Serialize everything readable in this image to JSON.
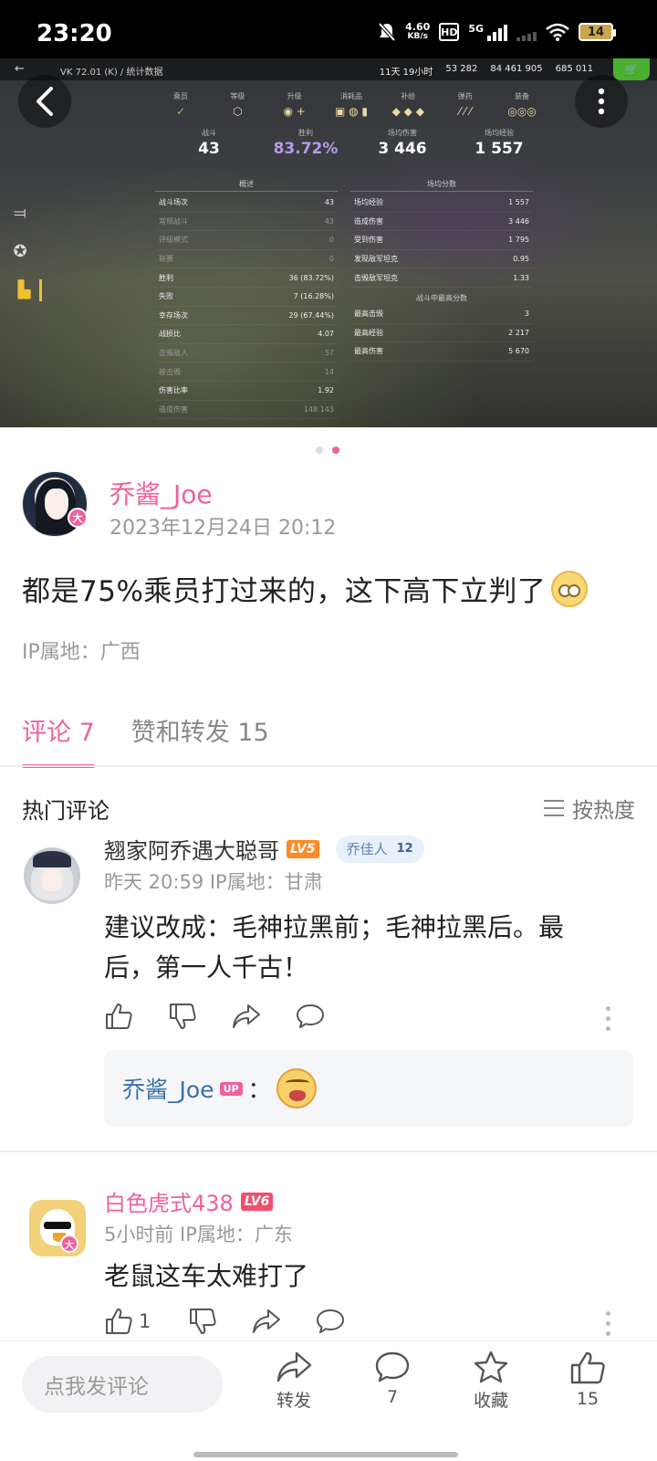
{
  "status_bar": {
    "time": "23:20",
    "net_speed_value": "4.60",
    "net_speed_unit": "KB/s",
    "hd": "HD",
    "network": "5G",
    "battery": "14"
  },
  "hero": {
    "topbar_title": "VK 72.01 (K) / 统计数据",
    "topbar_time": "11天 19小时",
    "topbar_gold": "53 282",
    "topbar_credits": "84 461 905",
    "topbar_xp": "685 011",
    "categories": [
      "乘员",
      "等级",
      "升级",
      "消耗品",
      "补给",
      "弹药",
      "装备"
    ],
    "big_stats": [
      {
        "label": "战斗",
        "value": "43"
      },
      {
        "label": "胜利",
        "value": "83.72%"
      },
      {
        "label": "场均伤害",
        "value": "3 446"
      },
      {
        "label": "场均经验",
        "value": "1 557"
      }
    ],
    "overview_title": "概述",
    "overview_rows": [
      {
        "label": "战斗场次",
        "value": "43"
      },
      {
        "label": "常规战斗",
        "value": "43"
      },
      {
        "label": "评级模式",
        "value": "0"
      },
      {
        "label": "联赛",
        "value": "0"
      },
      {
        "label": "胜利",
        "value": "36 (83.72%)"
      },
      {
        "label": "失败",
        "value": "7 (16.28%)"
      },
      {
        "label": "幸存场次",
        "value": "29 (67.44%)"
      },
      {
        "label": "战损比",
        "value": "4.07"
      },
      {
        "label": "击毁敌人",
        "value": "57"
      },
      {
        "label": "被击毁",
        "value": "14"
      },
      {
        "label": "伤害比率",
        "value": "1.92"
      },
      {
        "label": "造成伤害",
        "value": "148 143"
      }
    ],
    "avg_title": "场均分数",
    "avg_rows": [
      {
        "label": "场均经验",
        "value": "1 557"
      },
      {
        "label": "造成伤害",
        "value": "3 446"
      },
      {
        "label": "受到伤害",
        "value": "1 795"
      },
      {
        "label": "发现敌军坦克",
        "value": "0.95"
      },
      {
        "label": "击毁敌军坦克",
        "value": "1.33"
      }
    ],
    "best_title": "战斗中最高分数",
    "best_rows": [
      {
        "label": "最高击毁",
        "value": "3"
      },
      {
        "label": "最高经验",
        "value": "2 217"
      },
      {
        "label": "最高伤害",
        "value": "5 670"
      }
    ]
  },
  "post": {
    "author": "乔酱_Joe",
    "badge": "大",
    "date": "2023年12月24日 20:12",
    "text": "都是75%乘员打过来的，这下高下立判了",
    "ip": "IP属地：广西"
  },
  "tabs": [
    {
      "label": "评论 7"
    },
    {
      "label": "赞和转发 15"
    }
  ],
  "comments_header": {
    "title": "热门评论",
    "sort_label": "按热度"
  },
  "comments": [
    {
      "name": "翘家阿乔遇大聪哥",
      "level": "LV5",
      "fan_badge": "乔佳人",
      "fan_level": "12",
      "meta": "昨天 20:59   IP属地：甘肃",
      "text_line1": "建议改成：毛神拉黑前；毛神拉黑后。最",
      "text_line2": "后，第一人千古！",
      "reply_name": "乔酱_Joe",
      "reply_up": "UP",
      "reply_colon": "："
    },
    {
      "name": "白色虎式438",
      "level": "LV6",
      "badge": "大",
      "meta": "5小时前   IP属地：广东",
      "text": "老鼠这车太难打了",
      "likes": "1"
    }
  ],
  "bottom_bar": {
    "input_placeholder": "点我发评论",
    "share_label": "转发",
    "comment_count": "7",
    "favorite_label": "收藏",
    "like_count": "15"
  },
  "colors": {
    "accent": "#f0609c",
    "link": "#3b6fa8",
    "lv5": "#ff8a25",
    "lv6": "#f0506e"
  }
}
